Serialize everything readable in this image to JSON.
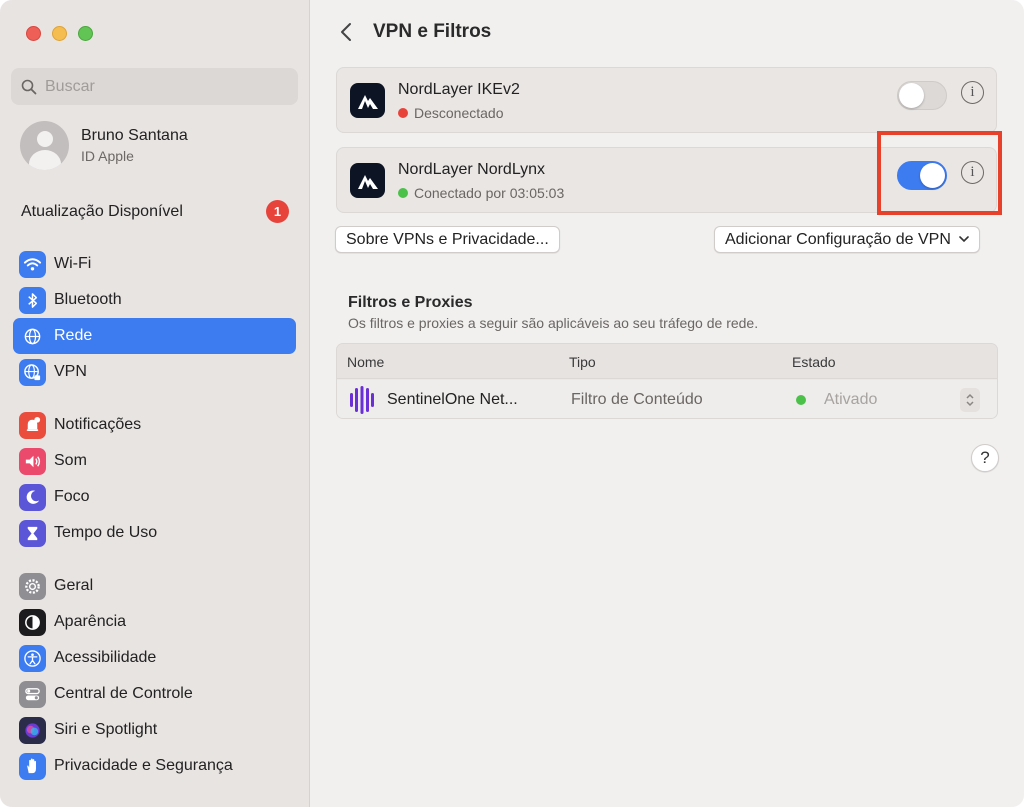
{
  "sidebar": {
    "search_placeholder": "Buscar",
    "profile": {
      "name": "Bruno Santana",
      "subtitle": "ID Apple"
    },
    "update": {
      "label": "Atualização Disponível",
      "badge": "1"
    },
    "items": [
      {
        "label": "Wi-Fi",
        "icon": "wifi-icon",
        "color": "#3d7bf0"
      },
      {
        "label": "Bluetooth",
        "icon": "bluetooth-icon",
        "color": "#3d7bf0"
      },
      {
        "label": "Rede",
        "icon": "globe-icon",
        "color": "#3d7bf0",
        "active": true
      },
      {
        "label": "VPN",
        "icon": "vpn-globe-icon",
        "color": "#3d7bf0"
      },
      {
        "label": "Notificações",
        "icon": "bell-icon",
        "color": "#eb4d3d"
      },
      {
        "label": "Som",
        "icon": "speaker-icon",
        "color": "#eb4a6c"
      },
      {
        "label": "Foco",
        "icon": "moon-icon",
        "color": "#5b55d8"
      },
      {
        "label": "Tempo de Uso",
        "icon": "hourglass-icon",
        "color": "#5b55d8"
      },
      {
        "label": "Geral",
        "icon": "gear-icon",
        "color": "#8e8e93"
      },
      {
        "label": "Aparência",
        "icon": "appearance-icon",
        "color": "#1c1c1e"
      },
      {
        "label": "Acessibilidade",
        "icon": "accessibility-icon",
        "color": "#3d7bf0"
      },
      {
        "label": "Central de Controle",
        "icon": "control-center-icon",
        "color": "#8e8e93"
      },
      {
        "label": "Siri e Spotlight",
        "icon": "siri-icon",
        "color": "#2b2b4a"
      },
      {
        "label": "Privacidade e Segurança",
        "icon": "hand-icon",
        "color": "#3d7bf0"
      }
    ]
  },
  "main": {
    "title": "VPN e Filtros",
    "vpns": [
      {
        "name": "NordLayer IKEv2",
        "status": "Desconectado",
        "status_color": "#e8433b",
        "enabled": false
      },
      {
        "name": "NordLayer NordLynx",
        "status": "Conectado por 03:05:03",
        "status_color": "#4cc14a",
        "enabled": true
      }
    ],
    "about_button": "Sobre VPNs e Privacidade...",
    "add_button": "Adicionar Configuração de VPN",
    "filters": {
      "title": "Filtros e Proxies",
      "subtitle": "Os filtros e proxies a seguir são aplicáveis ao seu tráfego de rede.",
      "columns": [
        "Nome",
        "Tipo",
        "Estado"
      ],
      "rows": [
        {
          "name": "SentinelOne Net...",
          "type": "Filtro de Conteúdo",
          "state": "Ativado",
          "state_color": "#4cc14a",
          "icon_color": "#6b2fd6"
        }
      ]
    },
    "help_label": "?"
  }
}
